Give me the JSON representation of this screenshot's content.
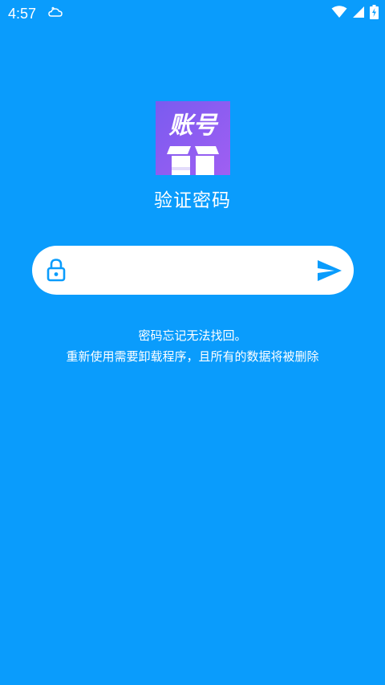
{
  "status_bar": {
    "time": "4:57",
    "notification_icon": "cloud-sync-icon",
    "wifi_icon": "wifi-icon",
    "signal_icon": "cell-signal-icon",
    "battery_icon": "battery-charging-icon"
  },
  "app_icon": {
    "text": "账号",
    "icon": "gift-box-icon",
    "gradient_start": "#7a5bf0",
    "gradient_end": "#a05ff2"
  },
  "title": "验证密码",
  "password_field": {
    "value": "",
    "placeholder": "",
    "lock_icon": "lock-icon",
    "send_icon": "send-icon"
  },
  "hint": {
    "line1": "密码忘记无法找回。",
    "line2": "重新使用需要卸载程序，且所有的数据将被删除"
  },
  "colors": {
    "background": "#0a9cfc",
    "accent": "#0a9cfc",
    "field_bg": "#ffffff"
  }
}
